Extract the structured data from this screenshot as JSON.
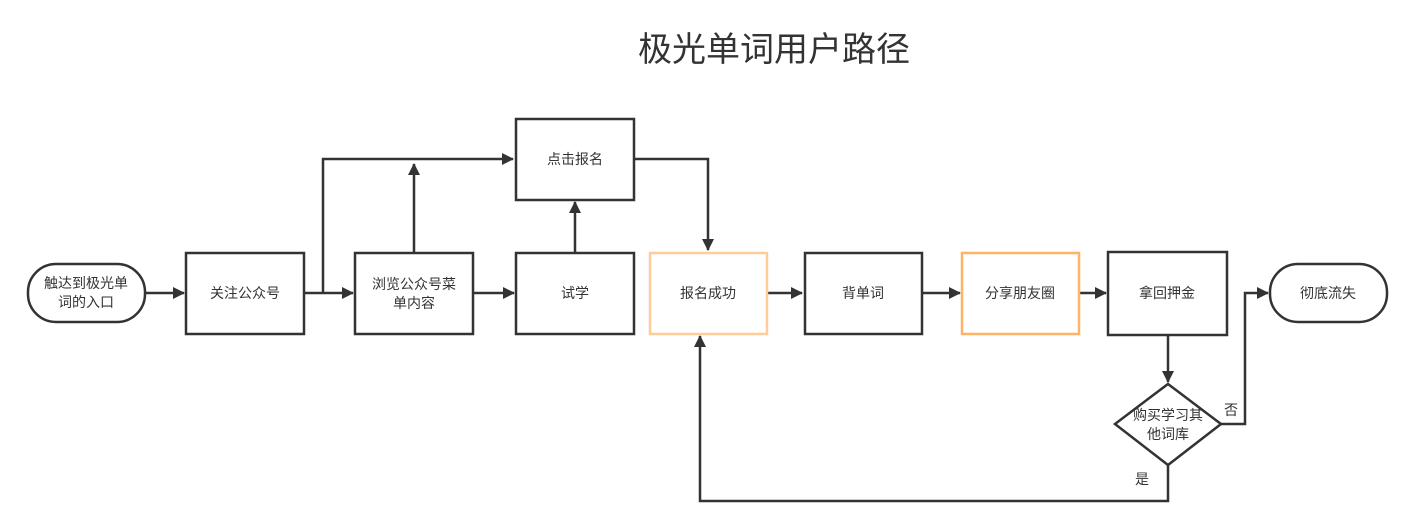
{
  "title": "极光单词用户路径",
  "colors": {
    "stroke": "#333333",
    "highlight": "#ffcc99",
    "highlight_strong": "#ffb366"
  },
  "nodes": {
    "entry": {
      "lines": [
        "触达到极光单",
        "词的入口"
      ],
      "shape": "terminal"
    },
    "follow": {
      "lines": [
        "关注公众号"
      ],
      "shape": "process"
    },
    "browse": {
      "lines": [
        "浏览公众号菜",
        "单内容"
      ],
      "shape": "process"
    },
    "click_signup": {
      "lines": [
        "点击报名"
      ],
      "shape": "process"
    },
    "trial": {
      "lines": [
        "试学"
      ],
      "shape": "process"
    },
    "signup_success": {
      "lines": [
        "报名成功"
      ],
      "shape": "process",
      "highlight": true
    },
    "memorize": {
      "lines": [
        "背单词"
      ],
      "shape": "process"
    },
    "share": {
      "lines": [
        "分享朋友圈"
      ],
      "shape": "process",
      "highlight": true
    },
    "refund": {
      "lines": [
        "拿回押金"
      ],
      "shape": "process"
    },
    "decision": {
      "lines": [
        "购买学习其",
        "他词库"
      ],
      "shape": "decision"
    },
    "churn": {
      "lines": [
        "彻底流失"
      ],
      "shape": "terminal"
    }
  },
  "edges": [
    {
      "from": "entry",
      "to": "follow"
    },
    {
      "from": "follow",
      "to": "browse"
    },
    {
      "from": "follow",
      "to": "click_signup"
    },
    {
      "from": "browse",
      "to": "click_signup"
    },
    {
      "from": "browse",
      "to": "trial"
    },
    {
      "from": "trial",
      "to": "click_signup"
    },
    {
      "from": "click_signup",
      "to": "signup_success"
    },
    {
      "from": "signup_success",
      "to": "memorize"
    },
    {
      "from": "memorize",
      "to": "share"
    },
    {
      "from": "share",
      "to": "refund"
    },
    {
      "from": "refund",
      "to": "decision"
    },
    {
      "from": "decision",
      "to": "churn",
      "label": "否"
    },
    {
      "from": "decision",
      "to": "signup_success",
      "label": "是"
    }
  ]
}
